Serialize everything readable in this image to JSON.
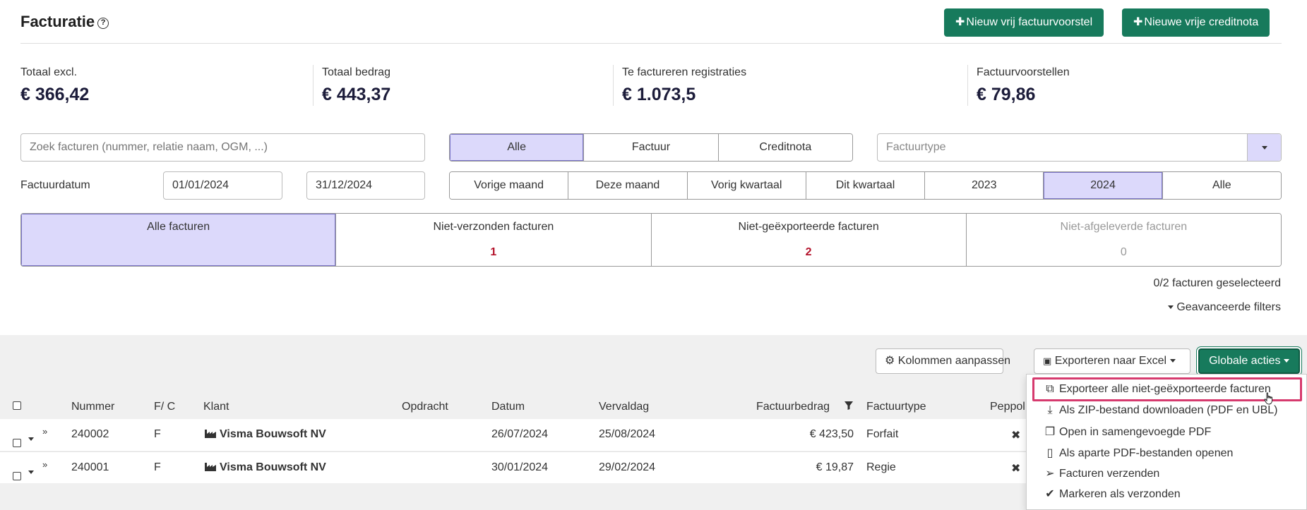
{
  "header": {
    "title": "Facturatie",
    "help_icon": "question-circle-icon",
    "btn_new_invoice": "Nieuw vrij factuurvoorstel",
    "btn_new_credit": "Nieuwe vrije creditnota"
  },
  "stats": [
    {
      "label": "Totaal excl.",
      "value": "€ 366,42"
    },
    {
      "label": "Totaal bedrag",
      "value": "€ 443,37"
    },
    {
      "label": "Te factureren registraties",
      "value": "€ 1.073,5"
    },
    {
      "label": "Factuurvoorstellen",
      "value": "€ 79,86"
    }
  ],
  "filters": {
    "search_placeholder": "Zoek facturen (nummer, relatie naam, OGM, ...)",
    "type_tabs": [
      "Alle",
      "Factuur",
      "Creditnota"
    ],
    "type_active": "Alle",
    "factuurtype_placeholder": "Factuurtype",
    "date_label": "Factuurdatum",
    "date_from": "01/01/2024",
    "date_to": "31/12/2024",
    "period_tabs": [
      "Vorige maand",
      "Deze maand",
      "Vorig kwartaal",
      "Dit kwartaal",
      "2023",
      "2024",
      "Alle"
    ],
    "period_active": "2024"
  },
  "cards": [
    {
      "title": "Alle facturen",
      "count": ""
    },
    {
      "title": "Niet-verzonden facturen",
      "count": "1"
    },
    {
      "title": "Niet-geëxporteerde facturen",
      "count": "2"
    },
    {
      "title": "Niet-afgeleverde facturen",
      "count": "0"
    }
  ],
  "selection": {
    "count_text": "0/2 facturen geselecteerd",
    "advanced_filters": "Geavanceerde filters"
  },
  "toolbar": {
    "columns_btn": "Kolommen aanpassen",
    "export_excel_btn": "Exporteren naar Excel",
    "global_actions_btn": "Globale acties"
  },
  "table": {
    "headers": {
      "nummer": "Nummer",
      "fc": "F/ C",
      "klant": "Klant",
      "opdracht": "Opdracht",
      "datum": "Datum",
      "vervaldag": "Vervaldag",
      "factuurbedrag": "Factuurbedrag",
      "factuurtype": "Factuurtype",
      "peppol": "Peppol"
    },
    "rows": [
      {
        "nummer": "240002",
        "fc": "F",
        "klant": "Visma Bouwsoft NV",
        "opdracht": "",
        "datum": "26/07/2024",
        "vervaldag": "25/08/2024",
        "bedrag": "€ 423,50",
        "type": "Forfait",
        "peppol": "✖"
      },
      {
        "nummer": "240001",
        "fc": "F",
        "klant": "Visma Bouwsoft NV",
        "opdracht": "",
        "datum": "30/01/2024",
        "vervaldag": "29/02/2024",
        "bedrag": "€ 19,87",
        "type": "Regie",
        "peppol": "✖"
      }
    ]
  },
  "menu": {
    "items": [
      {
        "label": "Exporteer alle niet-geëxporteerde facturen",
        "icon": "external-link-icon"
      },
      {
        "label": "Als ZIP-bestand downloaden (PDF en UBL)",
        "icon": "download-icon"
      },
      {
        "label": "Open in samengevoegde PDF",
        "icon": "copy-icon"
      },
      {
        "label": "Als aparte PDF-bestanden openen",
        "icon": "file-pdf-icon"
      },
      {
        "label": "Facturen verzenden",
        "icon": "paper-plane-icon"
      },
      {
        "label": "Markeren als verzonden",
        "icon": "check-icon"
      }
    ]
  },
  "colors": {
    "accent_green": "#177a5c",
    "active_bg": "#dcd9fb",
    "count_red": "#b3112a",
    "highlight": "#d63a6e"
  }
}
